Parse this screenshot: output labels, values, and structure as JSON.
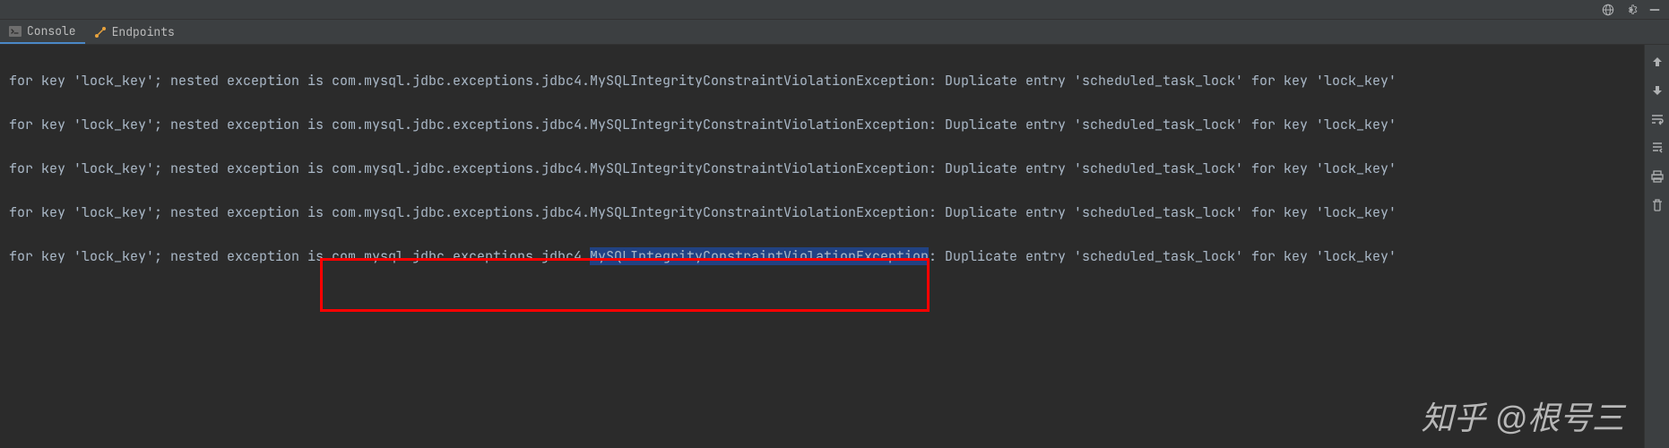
{
  "tabs": {
    "console": "Console",
    "endpoints": "Endpoints"
  },
  "log": {
    "prefix": "for key 'lock_key'; nested exception is ",
    "exception_path": "com.mysql.jdbc.exceptions.jdbc4.",
    "exception_class": "MySQLIntegrityConstraintViolationException",
    "suffix": ": Duplicate entry 'scheduled_task_lock' for key 'lock_key'"
  },
  "watermark": "知乎 @根号三"
}
